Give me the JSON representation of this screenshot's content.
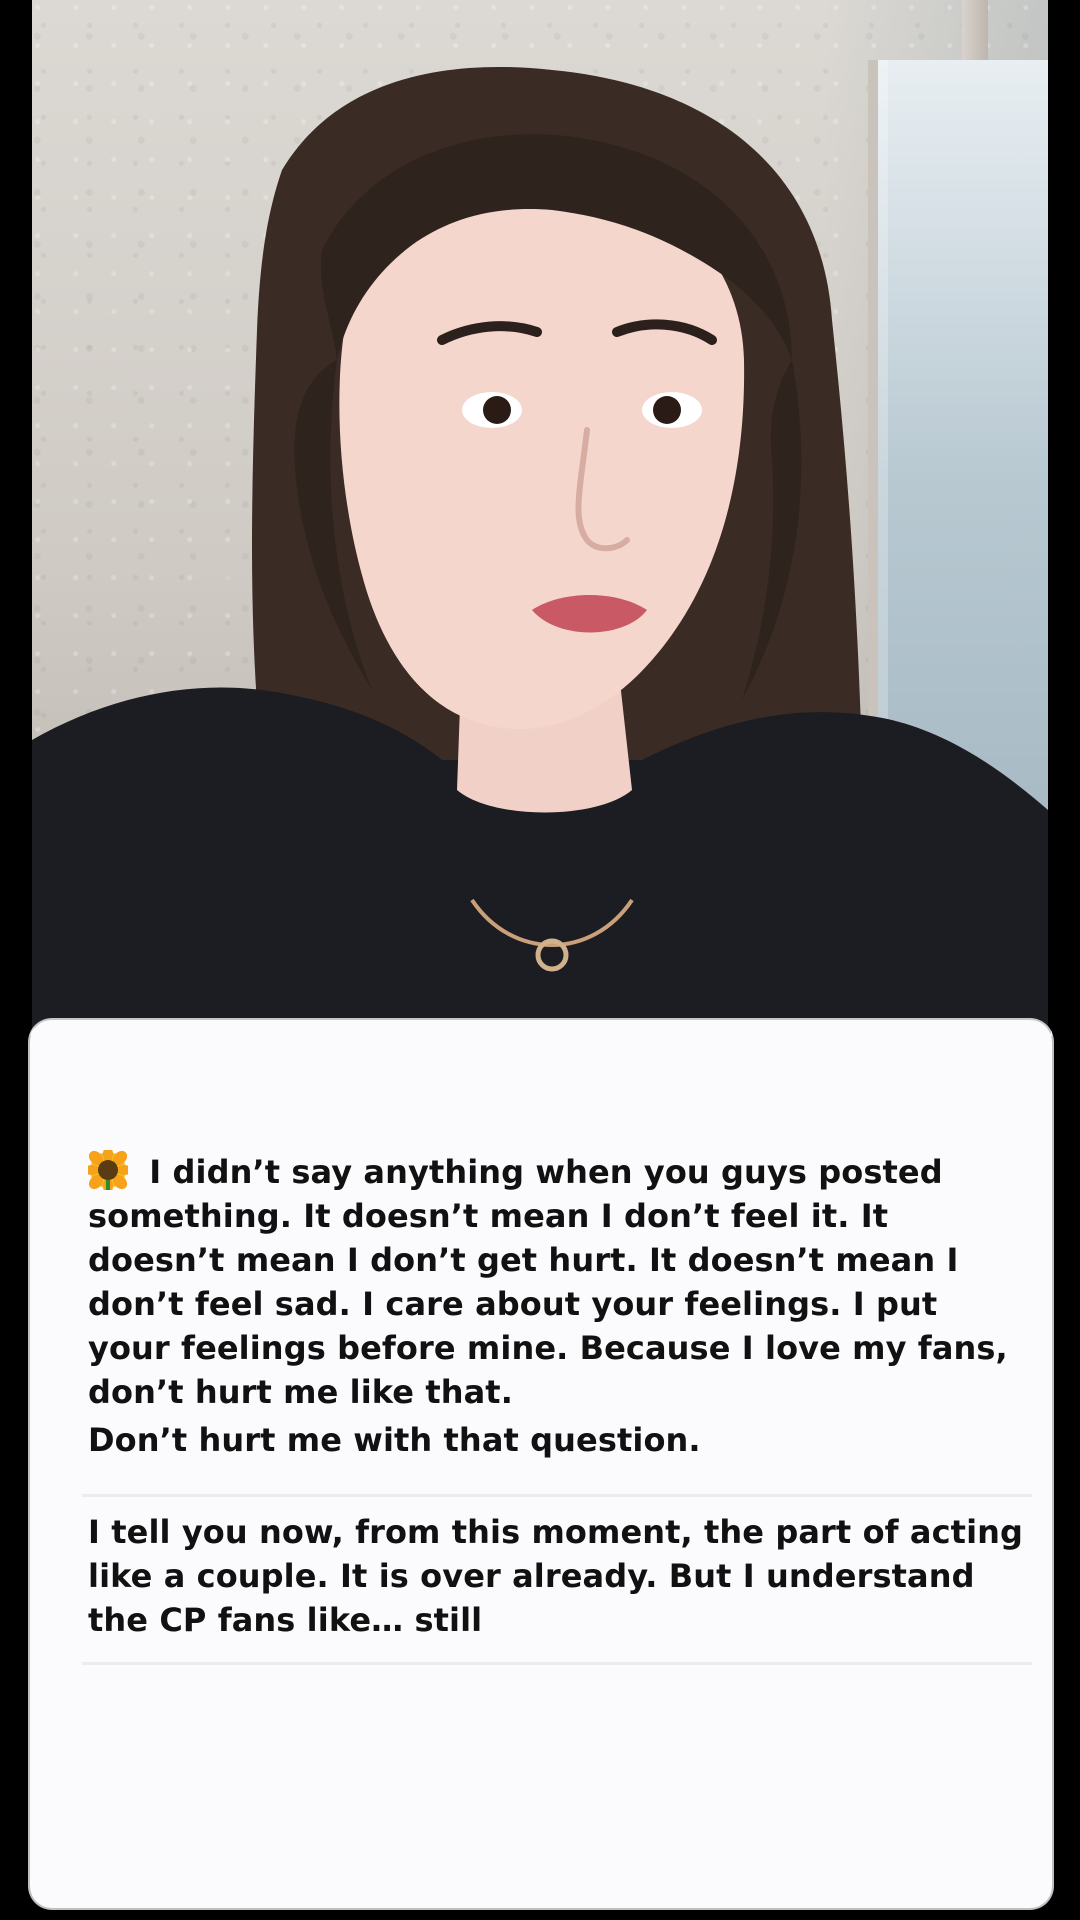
{
  "caption": {
    "emoji_name": "sunflower-icon",
    "paragraph_1": "I didn’t say anything when you guys posted something. It doesn’t mean I don’t feel it. It doesn’t mean I don’t get hurt. It doesn’t mean I don’t feel sad. I care about your feelings. I put your feelings before mine. Because I love my fans, don’t hurt me like that.",
    "paragraph_2": "Don’t hurt me with that question.",
    "paragraph_3": "I tell you now, from this moment, the part of acting like a couple. It is over already. But I understand the CP fans like… still"
  },
  "colors": {
    "panel_background": "#fbfbfd",
    "text": "#111111",
    "frame_background": "#000000"
  }
}
